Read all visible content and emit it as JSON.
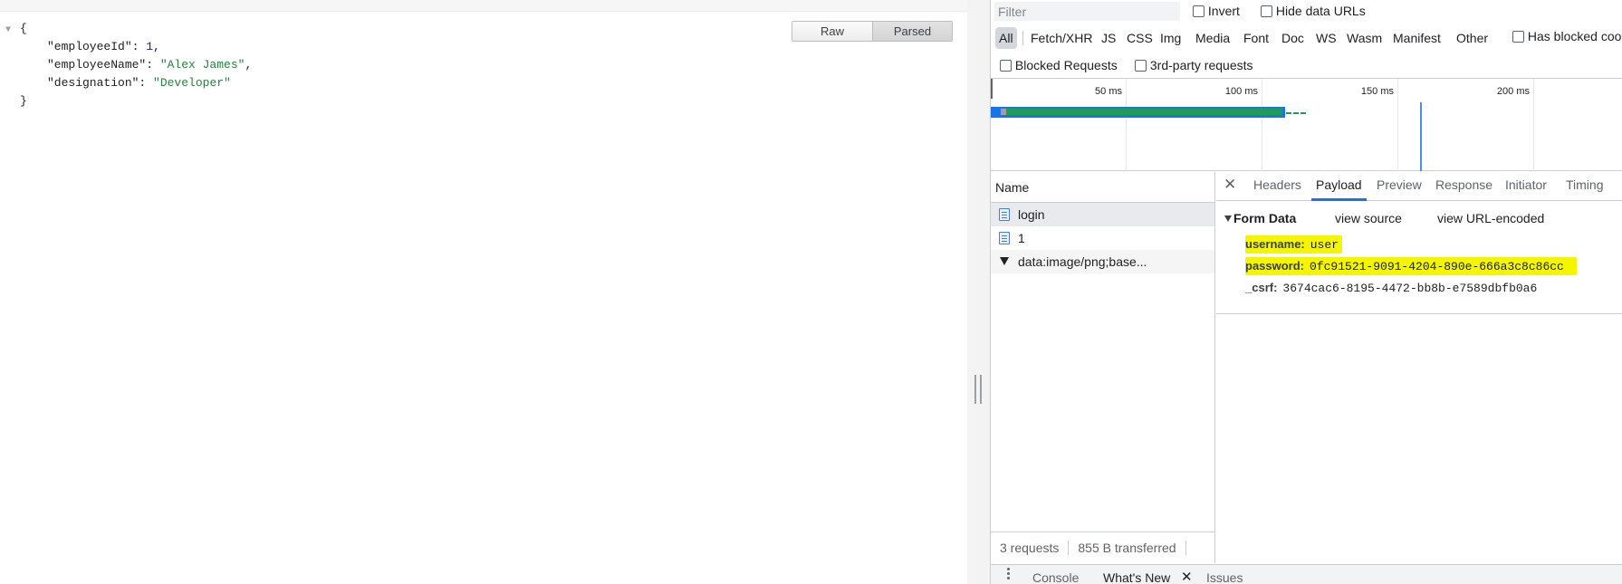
{
  "json_viewer": {
    "open_brace": "{",
    "close_brace": "}",
    "fields": [
      {
        "key": "\"employeeId\"",
        "value": "1",
        "type": "num",
        "trail": ","
      },
      {
        "key": "\"employeeName\"",
        "value": "\"Alex James\"",
        "type": "str",
        "trail": ","
      },
      {
        "key": "\"designation\"",
        "value": "\"Developer\"",
        "type": "str",
        "trail": ""
      }
    ],
    "toggle": {
      "raw": "Raw",
      "parsed": "Parsed",
      "selected": "Parsed"
    }
  },
  "devtools": {
    "filter": {
      "placeholder": "Filter",
      "value": ""
    },
    "options": {
      "invert": "Invert",
      "hide_data_urls": "Hide data URLs",
      "has_blocked_cookies": "Has blocked cookies",
      "blocked_requests": "Blocked Requests",
      "third_party": "3rd-party requests"
    },
    "types": [
      "All",
      "Fetch/XHR",
      "JS",
      "CSS",
      "Img",
      "Media",
      "Font",
      "Doc",
      "WS",
      "Wasm",
      "Manifest",
      "Other"
    ],
    "active_type": "All",
    "timeline": {
      "ticks": [
        "50 ms",
        "100 ms",
        "150 ms",
        "200 ms"
      ]
    },
    "name_header": "Name",
    "requests": [
      {
        "name": "login",
        "icon": "document-icon"
      },
      {
        "name": "1",
        "icon": "document-icon"
      },
      {
        "name": "data:image/png;base...",
        "icon": "image-icon"
      }
    ],
    "status": {
      "requests": "3 requests",
      "transferred": "855 B transferred"
    },
    "detail_tabs": [
      "Headers",
      "Payload",
      "Preview",
      "Response",
      "Initiator",
      "Timing"
    ],
    "active_detail_tab": "Payload",
    "form_data": {
      "title": "Form Data",
      "view_source": "view source",
      "view_url_encoded": "view URL-encoded",
      "fields": [
        {
          "key": "username:",
          "value": "user",
          "highlighted": true
        },
        {
          "key": "password:",
          "value": "0fc91521-9091-4204-890e-666a3c8c86cc",
          "highlighted": true
        },
        {
          "key": "_csrf:",
          "value": "3674cac6-8195-4472-bb8b-e7589dbfb0a6",
          "highlighted": false
        }
      ],
      "highlight_color": "#f4f500"
    },
    "drawer": {
      "tabs": [
        "Console",
        "What's New",
        "Issues"
      ],
      "active": "What's New"
    },
    "colors": {
      "accent": "#1a73e8",
      "timeline_green": "#1f9d55",
      "timeline_blue": "#1a73e8"
    }
  }
}
